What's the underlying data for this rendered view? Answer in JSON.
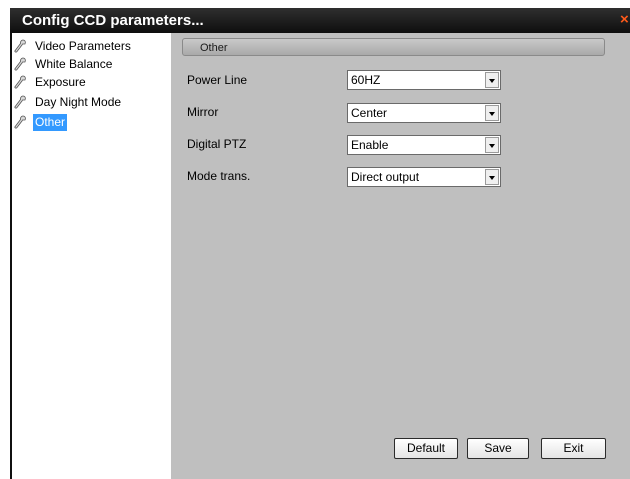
{
  "window": {
    "title": "Config CCD parameters...",
    "close_glyph": "×"
  },
  "sidebar": {
    "items": [
      {
        "label": "Video Parameters",
        "icon": "wrench-icon",
        "selected": false
      },
      {
        "label": "White Balance",
        "icon": "wrench-icon",
        "selected": false
      },
      {
        "label": "Exposure",
        "icon": "wrench-icon",
        "selected": false
      },
      {
        "label": "Day Night Mode",
        "icon": "wrench-icon",
        "selected": false
      },
      {
        "label": "Other",
        "icon": "wrench-icon",
        "selected": true
      }
    ]
  },
  "panel": {
    "section_title": "Other",
    "fields": [
      {
        "label": "Power Line",
        "value": "60HZ"
      },
      {
        "label": "Mirror",
        "value": "Center"
      },
      {
        "label": "Digital PTZ",
        "value": "Enable"
      },
      {
        "label": "Mode trans.",
        "value": "Direct output"
      }
    ]
  },
  "buttons": {
    "default_label": "Default",
    "save_label": "Save",
    "exit_label": "Exit"
  },
  "colors": {
    "titlebar": "#1a1a1a",
    "panel_bg": "#bfbfbf",
    "selection": "#3399ff",
    "close": "#ff5a1a"
  }
}
